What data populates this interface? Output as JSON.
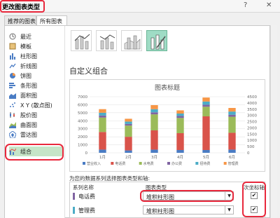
{
  "window": {
    "title": "更改图表类型"
  },
  "controls": {
    "help": "?",
    "close": "✕"
  },
  "tabs": [
    {
      "label": "推荐的图表"
    },
    {
      "label": "所有图表"
    }
  ],
  "sidebar": {
    "items": [
      {
        "label": "最近",
        "icon": "recent-icon"
      },
      {
        "label": "模板",
        "icon": "template-icon"
      },
      {
        "label": "柱形图",
        "icon": "column-chart-icon"
      },
      {
        "label": "折线图",
        "icon": "line-chart-icon"
      },
      {
        "label": "饼图",
        "icon": "pie-chart-icon"
      },
      {
        "label": "条形图",
        "icon": "bar-chart-icon"
      },
      {
        "label": "面积图",
        "icon": "area-chart-icon"
      },
      {
        "label": "X Y (散点图)",
        "icon": "scatter-chart-icon"
      },
      {
        "label": "股价图",
        "icon": "stock-chart-icon"
      },
      {
        "label": "曲面图",
        "icon": "surface-chart-icon"
      },
      {
        "label": "雷达图",
        "icon": "radar-chart-icon"
      },
      {
        "label": "组合",
        "icon": "combo-chart-icon"
      }
    ]
  },
  "main": {
    "heading": "自定义组合"
  },
  "chart_data": {
    "type": "bar",
    "title": "图表标题",
    "categories": [
      "1月",
      "2月",
      "3月",
      "4月",
      "5月",
      "6月"
    ],
    "left_axis": [
      "7000",
      "6000",
      "5000",
      "4000",
      "3000",
      "2000",
      "1000",
      "0"
    ],
    "right_axis": [
      "4500",
      "4000",
      "3500",
      "3000",
      "2500",
      "2000",
      "1500",
      "1000",
      "500",
      "0"
    ],
    "ylim": [
      0,
      7000
    ],
    "series": [
      {
        "name": "营业收入",
        "color": "#4a7cc4",
        "values": [
          400,
          300,
          400,
          350,
          350,
          400
        ]
      },
      {
        "name": "电话费",
        "color": "#d9534a",
        "values": [
          2200,
          1700,
          2400,
          2100,
          4200,
          2100
        ]
      },
      {
        "name": "水电费",
        "color": "#9bbb59",
        "values": [
          1800,
          1400,
          2000,
          1900,
          1200,
          2000
        ]
      },
      {
        "name": "办公费",
        "color": "#8064a2",
        "values": [
          250,
          200,
          250,
          250,
          250,
          250
        ]
      },
      {
        "name": "招待费",
        "color": "#4bacc6",
        "values": [
          350,
          300,
          400,
          300,
          400,
          400
        ]
      },
      {
        "name": "管理费",
        "color": "#f79646",
        "values": [
          450,
          350,
          500,
          400,
          500,
          450
        ]
      }
    ],
    "legend_position": "bottom",
    "grid": true
  },
  "series_config": {
    "prompt": "为您的数据系列选择图表类型和轴:",
    "headers": {
      "name": "系列名称",
      "type": "图表类型",
      "axis": "次坐标轴"
    },
    "rows": [
      {
        "name": "电话费",
        "type": "堆积柱形图",
        "color": "#8064a2",
        "secondary": true
      },
      {
        "name": "管理费",
        "type": "堆积柱形图",
        "color": "#4bacc6",
        "secondary": true
      }
    ]
  }
}
